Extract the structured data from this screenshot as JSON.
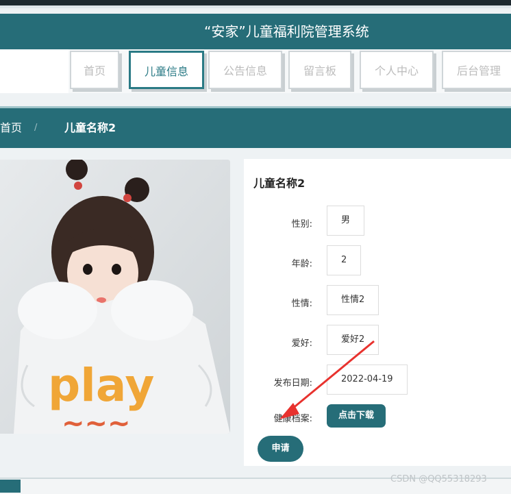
{
  "header": {
    "title": "“安家”儿童福利院管理系统"
  },
  "nav": {
    "items": [
      {
        "label": "首页",
        "active": false
      },
      {
        "label": "儿童信息",
        "active": true
      },
      {
        "label": "公告信息",
        "active": false
      },
      {
        "label": "留言板",
        "active": false
      },
      {
        "label": "个人中心",
        "active": false
      },
      {
        "label": "后台管理",
        "active": false
      }
    ]
  },
  "breadcrumb": {
    "home": "首页",
    "separator": "/",
    "current": "儿童名称2"
  },
  "detail": {
    "name": "儿童名称2",
    "fields": [
      {
        "label": "性别:",
        "value": "男"
      },
      {
        "label": "年龄:",
        "value": "2"
      },
      {
        "label": "性情:",
        "value": "性情2"
      },
      {
        "label": "爱好:",
        "value": "爱好2"
      },
      {
        "label": "发布日期:",
        "value": "2022-04-19"
      }
    ],
    "health_label": "健康档案:",
    "download_label": "点击下载",
    "apply_label": "申请"
  },
  "photo": {
    "shirt_text": "play"
  },
  "watermark": "CSDN @QQ55318293",
  "colors": {
    "primary": "#266d78",
    "arrow": "#e8322e"
  }
}
